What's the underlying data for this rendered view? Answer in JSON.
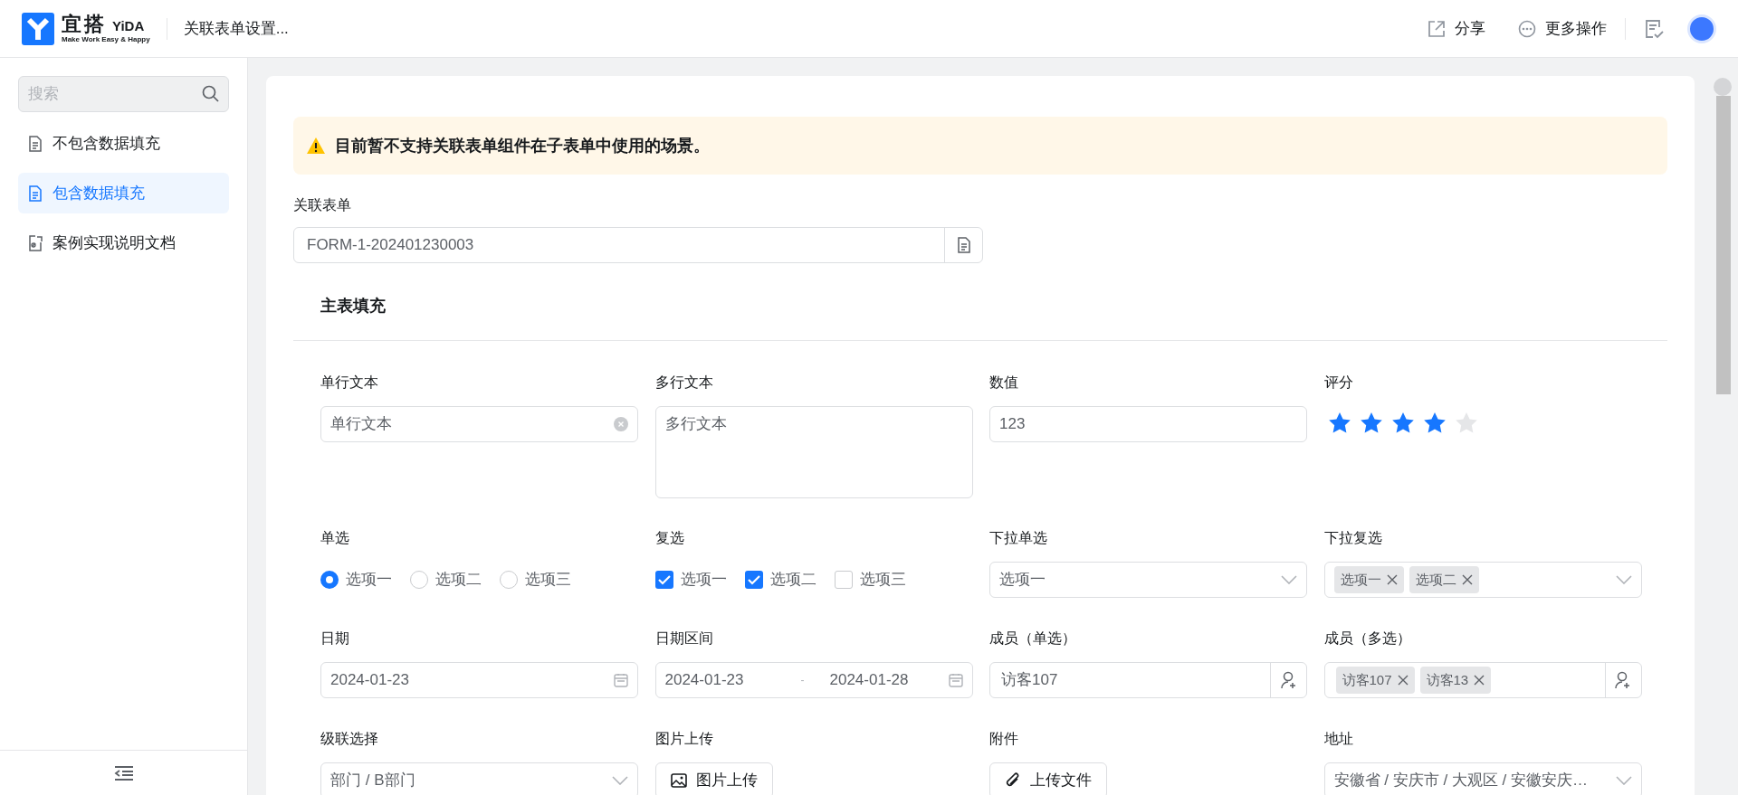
{
  "header": {
    "logo_name": "宜搭",
    "logo_brand": "YiDA",
    "logo_slogan": "Make Work Easy & Happy",
    "title": "关联表单设置...",
    "actions": [
      {
        "kind": "share",
        "label": "分享"
      },
      {
        "kind": "more",
        "label": "更多操作"
      }
    ]
  },
  "sidebar": {
    "search": {
      "placeholder": "搜索"
    },
    "items": [
      {
        "kind": "doc",
        "label": "不包含数据填充",
        "selected": false
      },
      {
        "kind": "doc",
        "label": "包含数据填充",
        "selected": true
      },
      {
        "kind": "link",
        "label": "案例实现说明文档",
        "selected": false
      }
    ]
  },
  "alert": {
    "text": "目前暂不支持关联表单组件在子表单中使用的场景。"
  },
  "related_form": {
    "label": "关联表单",
    "value": "FORM-1-202401230003"
  },
  "section": {
    "title": "主表填充",
    "fields": [
      {
        "kind": "text",
        "label": "单行文本",
        "value": "单行文本"
      },
      {
        "kind": "textarea",
        "label": "多行文本",
        "value": "多行文本"
      },
      {
        "kind": "number",
        "label": "数值",
        "value": "123"
      },
      {
        "kind": "rating",
        "label": "评分",
        "stars": 4
      },
      {
        "kind": "radio",
        "label": "单选",
        "options": [
          {
            "label": "选项一",
            "selected": true
          },
          {
            "label": "选项二",
            "selected": false
          },
          {
            "label": "选项三",
            "selected": false
          }
        ]
      },
      {
        "kind": "checkbox",
        "label": "复选",
        "options": [
          {
            "label": "选项一",
            "checked": true
          },
          {
            "label": "选项二",
            "checked": true
          },
          {
            "label": "选项三",
            "checked": false
          }
        ]
      },
      {
        "kind": "select",
        "label": "下拉单选",
        "value": "选项一"
      },
      {
        "kind": "multiselect",
        "label": "下拉复选",
        "tags": [
          "选项一",
          "选项二"
        ]
      },
      {
        "kind": "date",
        "label": "日期",
        "value": "2024-01-23"
      },
      {
        "kind": "daterange",
        "label": "日期区间",
        "start": "2024-01-23",
        "separator": "-",
        "end": "2024-01-28"
      },
      {
        "kind": "member",
        "label": "成员（单选）",
        "value": "访客107"
      },
      {
        "kind": "members",
        "label": "成员（多选）",
        "tags": [
          "访客107",
          "访客13"
        ]
      },
      {
        "kind": "select",
        "label": "级联选择",
        "value": "部门 / B部门"
      },
      {
        "kind": "image_upload",
        "label": "图片上传",
        "button": "图片上传"
      },
      {
        "kind": "file_upload",
        "label": "附件",
        "button": "上传文件"
      },
      {
        "kind": "select",
        "label": "地址",
        "value": "安徽省 / 安庆市 / 大观区 / 安徽安庆…"
      }
    ]
  }
}
